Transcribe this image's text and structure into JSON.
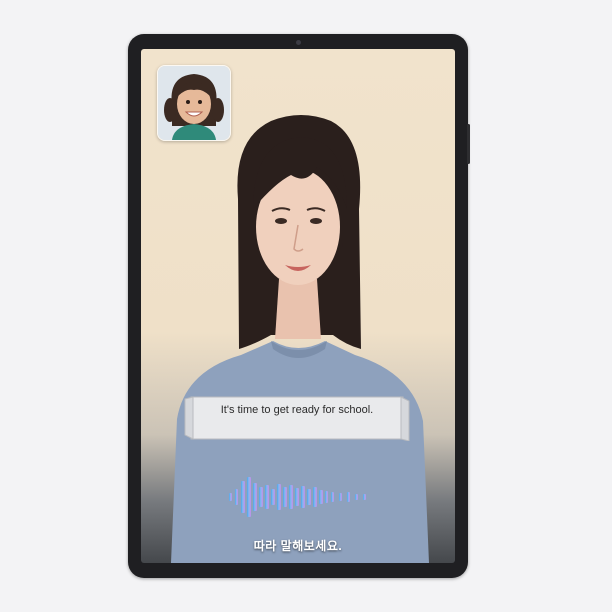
{
  "call": {
    "caption_text": "It's time to get ready for school.",
    "prompt_text": "따라 말해보세요."
  },
  "icons": {
    "waveform": "voice-waveform-icon",
    "self_view": "child-self-view-thumbnail"
  },
  "colors": {
    "background": "#f3f3f5",
    "bezel": "#1f1f22",
    "screen_backdrop": "#f1e3cc",
    "waveform_start": "#4aa8e8",
    "waveform_end": "#c48be6",
    "prompt_text": "#ffffff"
  }
}
